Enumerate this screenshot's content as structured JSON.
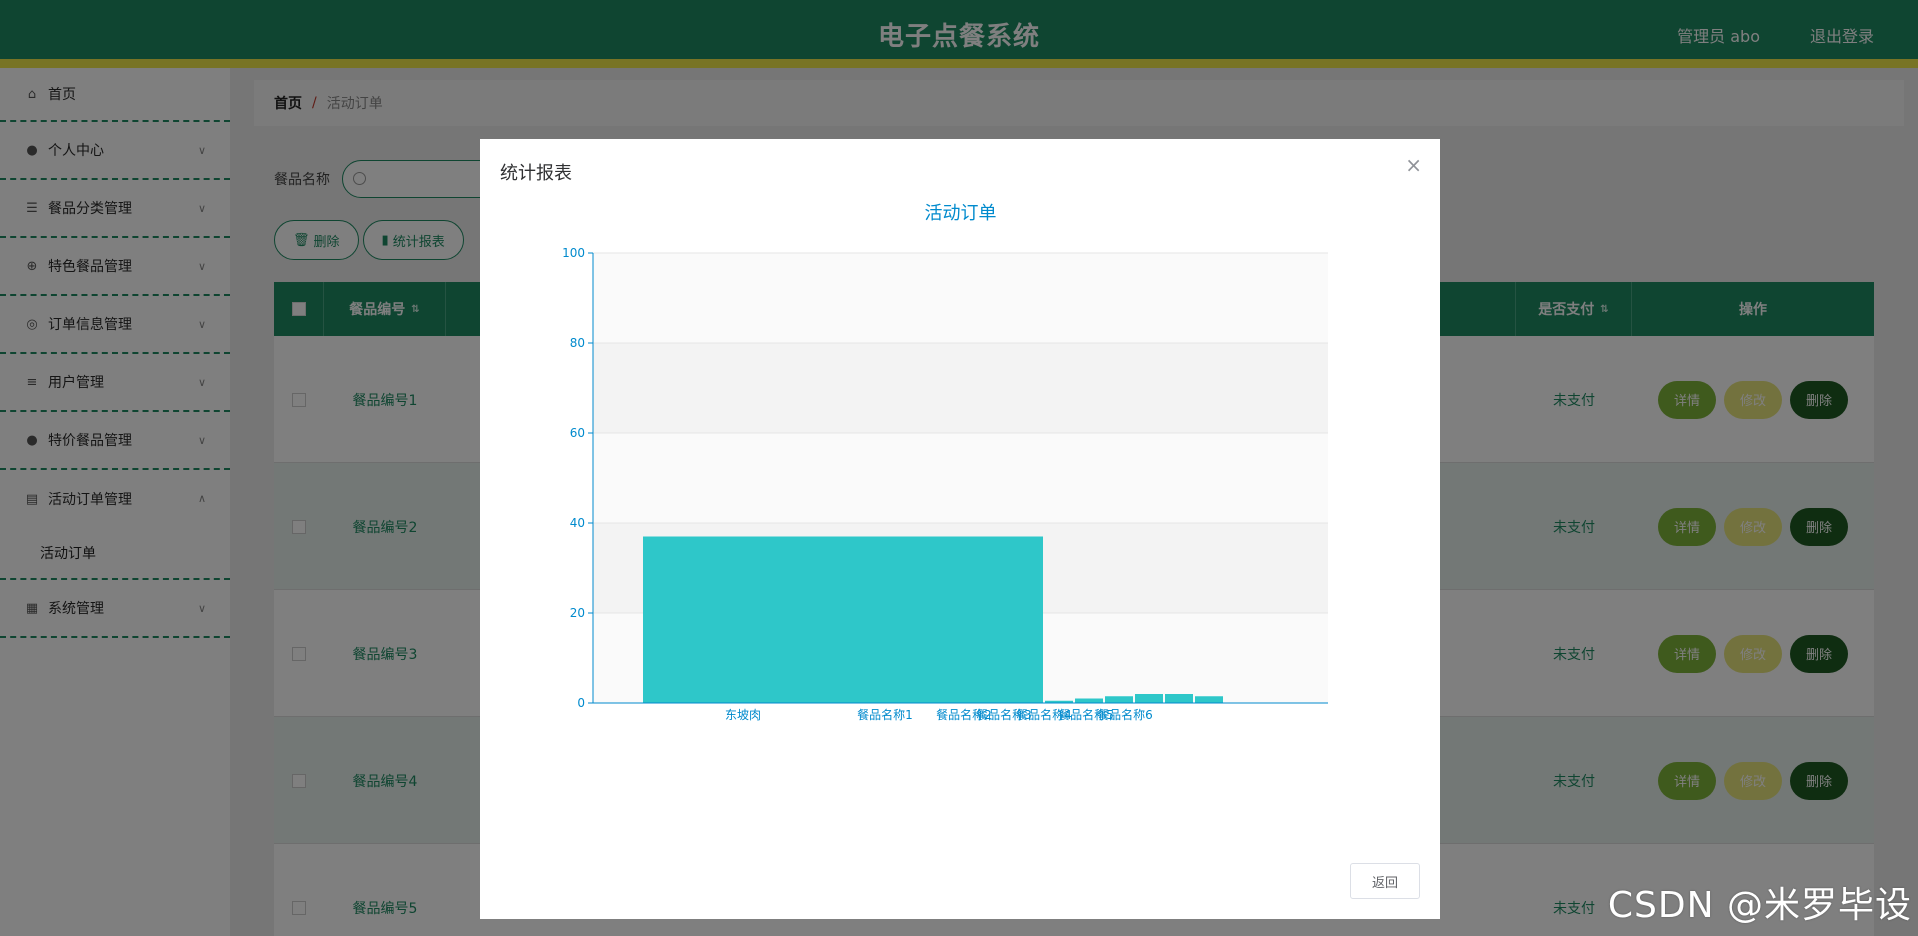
{
  "header": {
    "title": "电子点餐系统",
    "user": "管理员 abo",
    "logout": "退出登录"
  },
  "sidebar": {
    "items": [
      {
        "label": "首页",
        "icon": "home-icon"
      },
      {
        "label": "个人中心",
        "icon": "person-icon"
      },
      {
        "label": "餐品分类管理",
        "icon": "sliders-icon"
      },
      {
        "label": "特色餐品管理",
        "icon": "compass-icon"
      },
      {
        "label": "订单信息管理",
        "icon": "target-icon"
      },
      {
        "label": "用户管理",
        "icon": "list-icon"
      },
      {
        "label": "特价餐品管理",
        "icon": "bulb-icon"
      },
      {
        "label": "活动订单管理",
        "icon": "clipboard-icon"
      },
      {
        "label": "系统管理",
        "icon": "grid-icon"
      }
    ],
    "sub_item": "活动订单"
  },
  "breadcrumb": {
    "home": "首页",
    "sep": "/",
    "current": "活动订单"
  },
  "search": {
    "label": "餐品名称"
  },
  "buttons": {
    "delete": "删除",
    "report": "统计报表"
  },
  "table": {
    "headers": {
      "code": "餐品编号",
      "paid": "是否支付",
      "ops": "操作"
    },
    "rows": [
      {
        "code": "餐品编号1",
        "paid": "未支付"
      },
      {
        "code": "餐品编号2",
        "paid": "未支付"
      },
      {
        "code": "餐品编号3",
        "paid": "未支付"
      },
      {
        "code": "餐品编号4",
        "paid": "未支付"
      },
      {
        "code": "餐品编号5",
        "paid": "未支付"
      }
    ],
    "op_labels": {
      "detail": "详情",
      "edit": "修改",
      "delete": "删除"
    }
  },
  "modal": {
    "title": "统计报表",
    "close": "×",
    "back": "返回"
  },
  "chart_data": {
    "type": "bar",
    "title": "活动订单",
    "categories": [
      "东坡肉",
      "餐品名称1",
      "餐品名称2",
      "餐品名称3",
      "餐品名称4",
      "餐品名称5",
      "餐品名称6"
    ],
    "values": [
      37,
      0.5,
      1,
      1.5,
      2,
      2,
      1.5
    ],
    "ylim": [
      0,
      100
    ],
    "yticks": [
      0,
      20,
      40,
      60,
      80,
      100
    ],
    "bar_color": "#2ec7c9",
    "axis_color": "#008acd"
  },
  "watermark": "CSDN @米罗毕设"
}
